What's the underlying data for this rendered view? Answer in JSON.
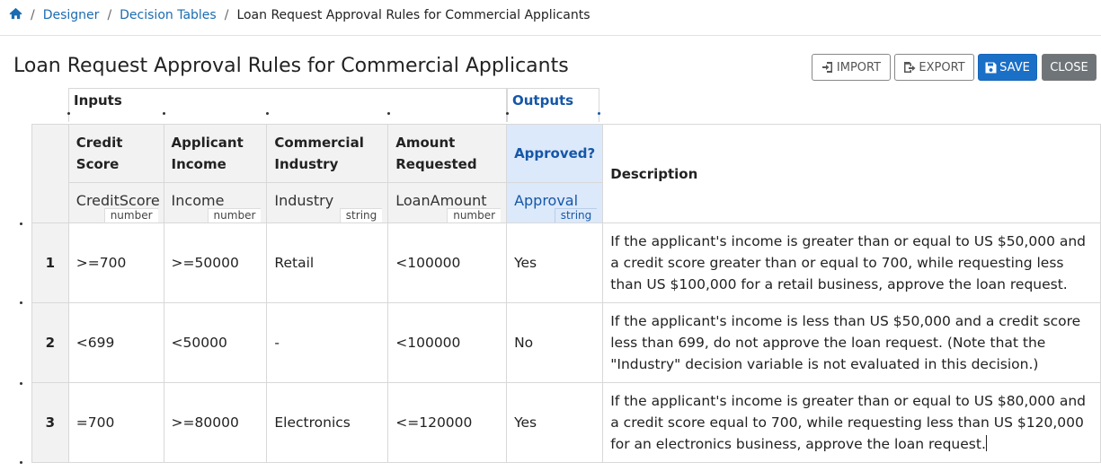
{
  "breadcrumb": {
    "home_icon": "home-icon",
    "items": [
      "Designer",
      "Decision Tables"
    ],
    "current": "Loan Request Approval Rules for Commercial Applicants"
  },
  "page_title": "Loan Request Approval Rules for Commercial Applicants",
  "toolbar": {
    "import_label": "IMPORT",
    "export_label": "EXPORT",
    "save_label": "SAVE",
    "close_label": "CLOSE"
  },
  "groups": {
    "inputs": "Inputs",
    "outputs": "Outputs"
  },
  "columns": [
    {
      "label": "Credit Score",
      "variable": "CreditScore",
      "type": "number"
    },
    {
      "label": "Applicant Income",
      "variable": "Income",
      "type": "number"
    },
    {
      "label": "Commercial Industry",
      "variable": "Industry",
      "type": "string"
    },
    {
      "label": "Amount Requested",
      "variable": "LoanAmount",
      "type": "number"
    },
    {
      "label": "Approved?",
      "variable": "Approval",
      "type": "string"
    }
  ],
  "description_header": "Description",
  "rows": [
    {
      "num": "1",
      "cells": [
        ">=700",
        ">=50000",
        "Retail",
        "<100000",
        "Yes"
      ],
      "description": "If the applicant's income is greater than or equal to US $50,000 and a credit score greater than or equal to 700, while requesting less than US $100,000 for a retail business, approve the loan request."
    },
    {
      "num": "2",
      "cells": [
        "<699",
        "<50000",
        "-",
        "<100000",
        "No"
      ],
      "description": "If the applicant's income is less than US $50,000 and a credit score less than 699, do not approve the loan request. (Note that the \"Industry\" decision variable is not evaluated in this decision.)"
    },
    {
      "num": "3",
      "cells": [
        "=700",
        ">=80000",
        "Electronics",
        "<=120000",
        "Yes"
      ],
      "description": "If the applicant's income is greater than or equal to US $80,000 and a credit score equal to 700, while requesting less than US $120,000 for an electronics business, approve the loan request."
    }
  ],
  "colors": {
    "link": "#1b6cb0",
    "save": "#1a70c7",
    "close": "#6f7478",
    "output_bg": "#dce9fa",
    "output_text": "#1557a8"
  }
}
